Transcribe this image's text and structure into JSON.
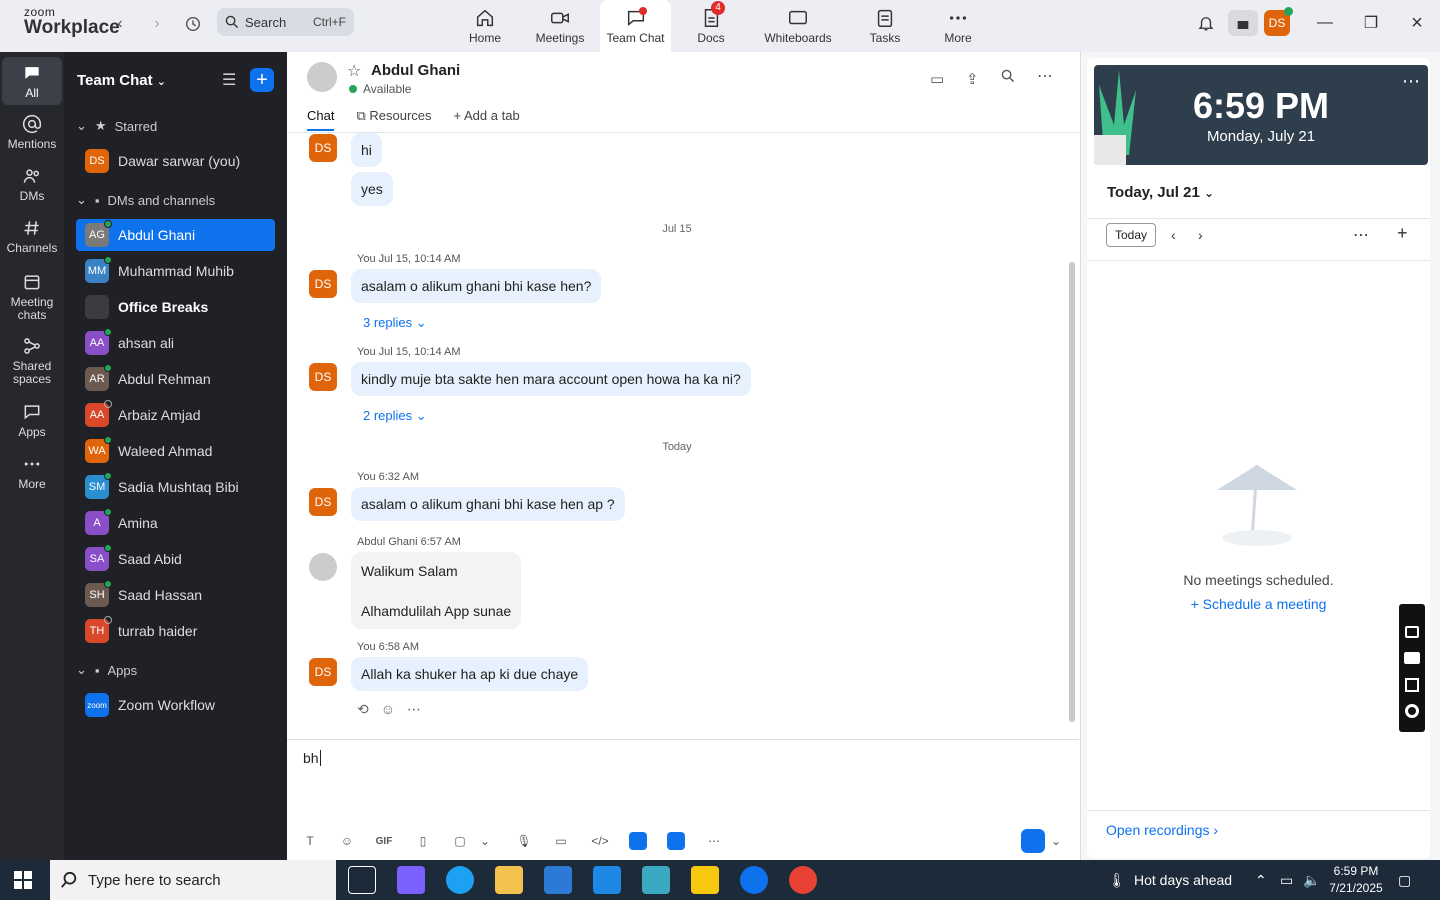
{
  "app": {
    "logo_top": "zoom",
    "logo_bottom": "Workplace",
    "search_placeholder": "Search",
    "search_shortcut": "Ctrl+F",
    "nav": [
      "Home",
      "Meetings",
      "Team Chat",
      "Docs",
      "Whiteboards",
      "Tasks",
      "More"
    ],
    "docs_badge": "4",
    "user_initials": "DS"
  },
  "rail": {
    "items": [
      "All",
      "Mentions",
      "DMs",
      "Channels",
      "Meeting chats",
      "Shared spaces",
      "Apps",
      "More"
    ]
  },
  "sidebar": {
    "title": "Team Chat",
    "sections": {
      "starred": "Starred",
      "dms": "DMs and channels",
      "apps": "Apps"
    },
    "starred": [
      {
        "initials": "DS",
        "name": "Dawar sarwar (you)",
        "color": "#e0640a"
      }
    ],
    "contacts": [
      {
        "initials": "AG",
        "name": "Abdul Ghani",
        "color": "#7a7a7a",
        "active": true
      },
      {
        "initials": "MM",
        "name": "Muhammad Muhib",
        "color": "#3b82c4"
      },
      {
        "initials": "",
        "name": "Office Breaks",
        "color": "#3a3c42",
        "bold": true
      },
      {
        "initials": "AA",
        "name": "ahsan ali",
        "color": "#8a4fc8"
      },
      {
        "initials": "AR",
        "name": "Abdul Rehman",
        "color": "#6b5a50"
      },
      {
        "initials": "AA",
        "name": "Arbaiz Amjad",
        "color": "#d9482b"
      },
      {
        "initials": "WA",
        "name": "Waleed Ahmad",
        "color": "#e0640a"
      },
      {
        "initials": "SM",
        "name": "Sadia Mushtaq Bibi",
        "color": "#2a8fd1"
      },
      {
        "initials": "A",
        "name": "Amina",
        "color": "#8a4fc8"
      },
      {
        "initials": "SA",
        "name": "Saad Abid",
        "color": "#8a4fc8"
      },
      {
        "initials": "SH",
        "name": "Saad Hassan",
        "color": "#6b5a50"
      },
      {
        "initials": "TH",
        "name": "turrab haider",
        "color": "#d9482b"
      }
    ],
    "apps": [
      {
        "initials": "zoom",
        "name": "Zoom Workflow",
        "color": "#0e72ed"
      }
    ]
  },
  "chat": {
    "contact_name": "Abdul Ghani",
    "status": "Available",
    "tabs": [
      "Chat",
      "Resources",
      "Add a tab"
    ],
    "messages": {
      "m0a": "hi",
      "m0b": "yes",
      "sep1": "Jul 15",
      "meta1": "You Jul 15, 10:14 AM",
      "m1": "asalam o alikum ghani bhi kase hen?",
      "r1": "3 replies",
      "meta2": "You Jul 15, 10:14 AM",
      "m2": "kindly muje bta sakte hen mara account open howa ha ka ni?",
      "r2": "2 replies",
      "sep2": "Today",
      "meta3": "You 6:32 AM",
      "m3": "asalam o alikum ghani bhi kase hen ap ?",
      "meta4": "Abdul Ghani 6:57 AM",
      "m4a": "Walikum Salam",
      "m4b": "Alhamdulilah App sunae",
      "meta5": "You 6:58 AM",
      "m5": "Allah ka shuker ha ap ki due chaye"
    },
    "composer_text": "bh",
    "avatar_initials": "DS"
  },
  "calendar": {
    "time": "6:59 PM",
    "date": "Monday, July 21",
    "heading": "Today, Jul 21",
    "today_button": "Today",
    "no_meetings": "No meetings scheduled.",
    "schedule": "Schedule a meeting",
    "open_recordings": "Open recordings"
  },
  "taskbar": {
    "search": "Type here to search",
    "weather": "Hot days ahead",
    "time": "6:59 PM",
    "date": "7/21/2025"
  }
}
